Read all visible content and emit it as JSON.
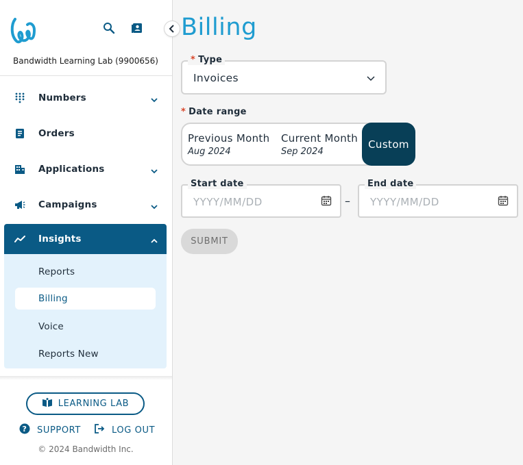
{
  "sidebar": {
    "account": "Bandwidth Learning Lab (9900656)",
    "items": [
      {
        "label": "Numbers",
        "icon": "grid-dots-icon",
        "expandable": true
      },
      {
        "label": "Orders",
        "icon": "clipboard-icon",
        "expandable": false
      },
      {
        "label": "Applications",
        "icon": "building-icon",
        "expandable": true
      },
      {
        "label": "Campaigns",
        "icon": "megaphone-icon",
        "expandable": true
      },
      {
        "label": "Insights",
        "icon": "trend-line-icon",
        "expandable": true,
        "expanded": true
      }
    ],
    "insights_children": [
      "Reports",
      "Billing",
      "Voice",
      "Reports New"
    ],
    "active_child": "Billing",
    "learning_lab": "LEARNING LAB",
    "support": "SUPPORT",
    "logout": "LOG OUT",
    "copyright": "© 2024 Bandwidth Inc."
  },
  "main": {
    "title": "Billing",
    "type_label": "Type",
    "type_value": "Invoices",
    "date_range_label": "Date range",
    "required_mark": "*",
    "range_options": [
      {
        "label": "Previous Month",
        "sub": "Aug 2024"
      },
      {
        "label": "Current Month",
        "sub": "Sep 2024"
      },
      {
        "label": "Custom",
        "sub": ""
      }
    ],
    "selected_range": "Custom",
    "start_label": "Start date",
    "end_label": "End date",
    "date_placeholder": "YYYY/MM/DD",
    "separator": "–",
    "submit": "SUBMIT"
  },
  "colors": {
    "brand": "#0a5a85",
    "title": "#1f9cd0",
    "selected_option": "#083f57",
    "required": "#d9472b",
    "submenu_bg": "#e3f2fc"
  }
}
